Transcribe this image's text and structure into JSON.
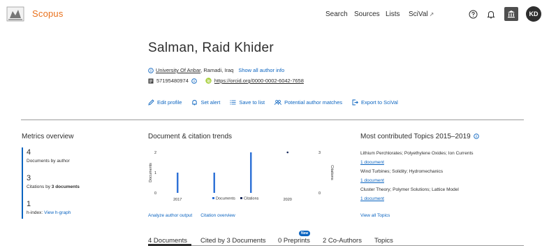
{
  "header": {
    "brand": "Scopus",
    "nav": {
      "search": "Search",
      "sources": "Sources",
      "lists": "Lists",
      "scival": "SciVal",
      "scival_ext": "↗"
    },
    "avatar_initials": "KD",
    "icons": [
      "help-icon",
      "bell-icon",
      "institution-icon"
    ]
  },
  "author": {
    "name": "Salman, Raid Khider",
    "affiliation_institution": "University Of Anbar",
    "affiliation_location": ", Ramadi, Iraq",
    "show_all_info": "Show all author info",
    "author_id": "57195480974",
    "orcid": "https://orcid.org/0000-0002-6042-7658"
  },
  "actions": {
    "edit_profile": "Edit profile",
    "set_alert": "Set alert",
    "save_to_list": "Save to list",
    "potential_matches": "Potential author matches",
    "export_scival": "Export to SciVal"
  },
  "metrics": {
    "title": "Metrics overview",
    "documents_value": "4",
    "documents_label": "Documents by author",
    "citations_value": "3",
    "citations_label_pre": "Citations by ",
    "citations_label_bold": "3 documents",
    "hindex_value": "1",
    "hindex_label": "h-index:",
    "hindex_link": "View h-graph"
  },
  "trends": {
    "title": "Document & citation trends",
    "analyze_link": "Analyze author output",
    "citation_link": "Citation overview"
  },
  "chart_data": {
    "type": "bar",
    "title": "Document & citation trends",
    "xlabel": "",
    "ylabel_left": "Documents",
    "ylabel_right": "Citations",
    "x_tick_labels": [
      "2017",
      "2020"
    ],
    "years": [
      2017,
      2018,
      2019,
      2020
    ],
    "series": [
      {
        "name": "Documents",
        "type": "bar",
        "values": [
          1,
          1,
          2,
          0
        ]
      },
      {
        "name": "Citations",
        "type": "scatter",
        "values": [
          0,
          0,
          0,
          3
        ]
      }
    ],
    "ylim_left": [
      0,
      2
    ],
    "ylim_right": [
      0,
      3
    ],
    "y_ticks_left": [
      "2",
      "1",
      "0"
    ],
    "y_ticks_right": [
      "3",
      "0"
    ],
    "legend_position": "bottom",
    "colors": {
      "documents": "#2b6fd6",
      "citations": "#1a2b5c"
    }
  },
  "topics": {
    "title": "Most contributed Topics 2015–2019",
    "items": [
      {
        "name": "Lithium Perchlorates; Polyethylene Oxides; Ion Currents",
        "docs": "1 document"
      },
      {
        "name": "Wind Turbines; Solidity; Hydromechanics",
        "docs": "1 document"
      },
      {
        "name": "Cluster Theory; Polymer Solutions; Lattice Model",
        "docs": "1 document"
      }
    ],
    "view_all": "View all Topics"
  },
  "tabs": {
    "documents": "4 Documents",
    "cited_by": "Cited by 3 Documents",
    "preprints": "0 Preprints",
    "preprints_badge": "New",
    "coauthors": "2 Co-Authors",
    "topics": "Topics"
  },
  "colors": {
    "brand": "#e9711c",
    "link": "#0b64c0",
    "text": "#2e2e2e"
  }
}
